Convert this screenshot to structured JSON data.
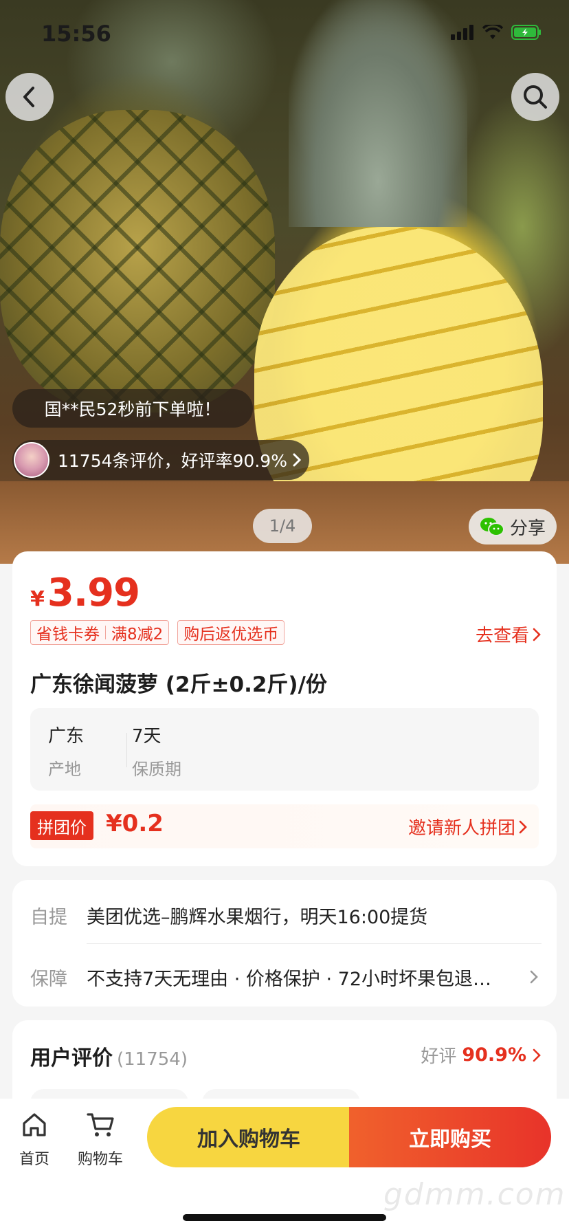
{
  "status_bar": {
    "time": "15:56"
  },
  "gallery": {
    "counter": "1/4",
    "share_label": "分享",
    "recent_order": "国**民52秒前下单啦！",
    "reviews_summary": "11754条评价，好评率90.9%"
  },
  "product": {
    "currency": "¥",
    "price": "3.99",
    "tags": [
      {
        "a": "省钱卡券",
        "b": "满8减2"
      },
      {
        "a": "购后返优选币"
      }
    ],
    "check_link": "去查看",
    "title": "广东徐闻菠萝 (2斤±0.2斤)/份",
    "specs": [
      {
        "value": "广东",
        "key": "产地"
      },
      {
        "value": "7天",
        "key": "保质期"
      }
    ],
    "group_badge": "拼团价",
    "group_price": "¥0.2",
    "invite_link": "邀请新人拼团"
  },
  "service": {
    "pickup_key": "自提",
    "pickup_value": "美团优选–鹏辉水果烟行，明天16:00提货",
    "guarantee_key": "保障",
    "guarantee_value": "不支持7天无理由 · 价格保护 · 72小时坏果包退…"
  },
  "reviews": {
    "title": "用户评价",
    "count": "(11754)",
    "rating_label": "好评",
    "rating_value": "90.9%"
  },
  "bottom_bar": {
    "home_label": "首页",
    "cart_label": "购物车",
    "add_to_cart": "加入购物车",
    "buy_now": "立即购买",
    "watermark": "gdmm.com"
  },
  "colors": {
    "accent": "#e5301e",
    "cart_button": "#f7d640",
    "buy_button": "#e8332a"
  }
}
